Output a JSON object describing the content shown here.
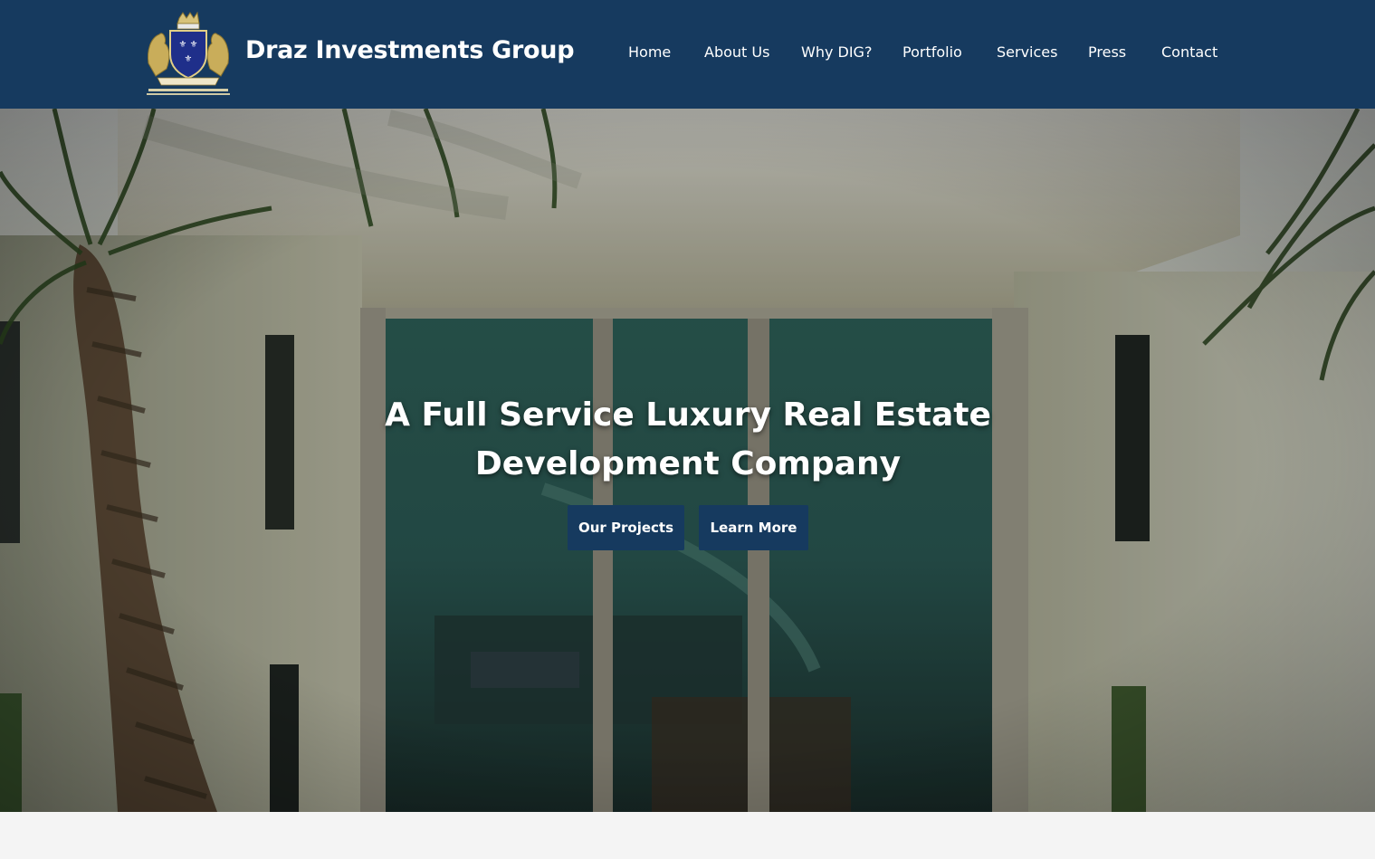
{
  "header": {
    "brand": "Draz Investments Group",
    "logo_icon": "crest-logo-icon",
    "background_color": "#163a5f",
    "nav": [
      {
        "label": "Home"
      },
      {
        "label": "About Us"
      },
      {
        "label": "Why DIG?"
      },
      {
        "label": "Portfolio"
      },
      {
        "label": "Services"
      },
      {
        "label": "Press"
      },
      {
        "label": "Contact"
      }
    ]
  },
  "hero": {
    "title_line1": "A Full Service Luxury Real Estate",
    "title_line2": "Development Company",
    "buttons": {
      "projects": "Our Projects",
      "learn_more": "Learn More"
    },
    "button_color": "#163a5f"
  }
}
